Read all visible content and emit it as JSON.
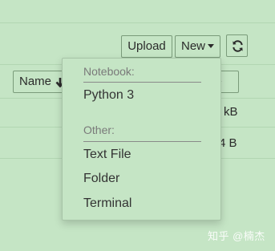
{
  "toolbar": {
    "upload_label": "Upload",
    "new_label": "New",
    "refresh_icon": "refresh-icon"
  },
  "file_list": {
    "columns": {
      "name_label": "Name",
      "size_label_partial": "ze"
    },
    "rows": [
      {
        "size_partial": "kB"
      },
      {
        "size_partial": "4 B"
      }
    ]
  },
  "new_menu": {
    "notebook_header": "Notebook:",
    "notebook_items": [
      "Python 3"
    ],
    "other_header": "Other:",
    "other_items": [
      "Text File",
      "Folder",
      "Terminal"
    ]
  },
  "watermark": "知乎 @楠杰",
  "colors": {
    "background": "#c5e5c5",
    "border": "#7a9b7a",
    "header_text": "#7a7a7a"
  }
}
